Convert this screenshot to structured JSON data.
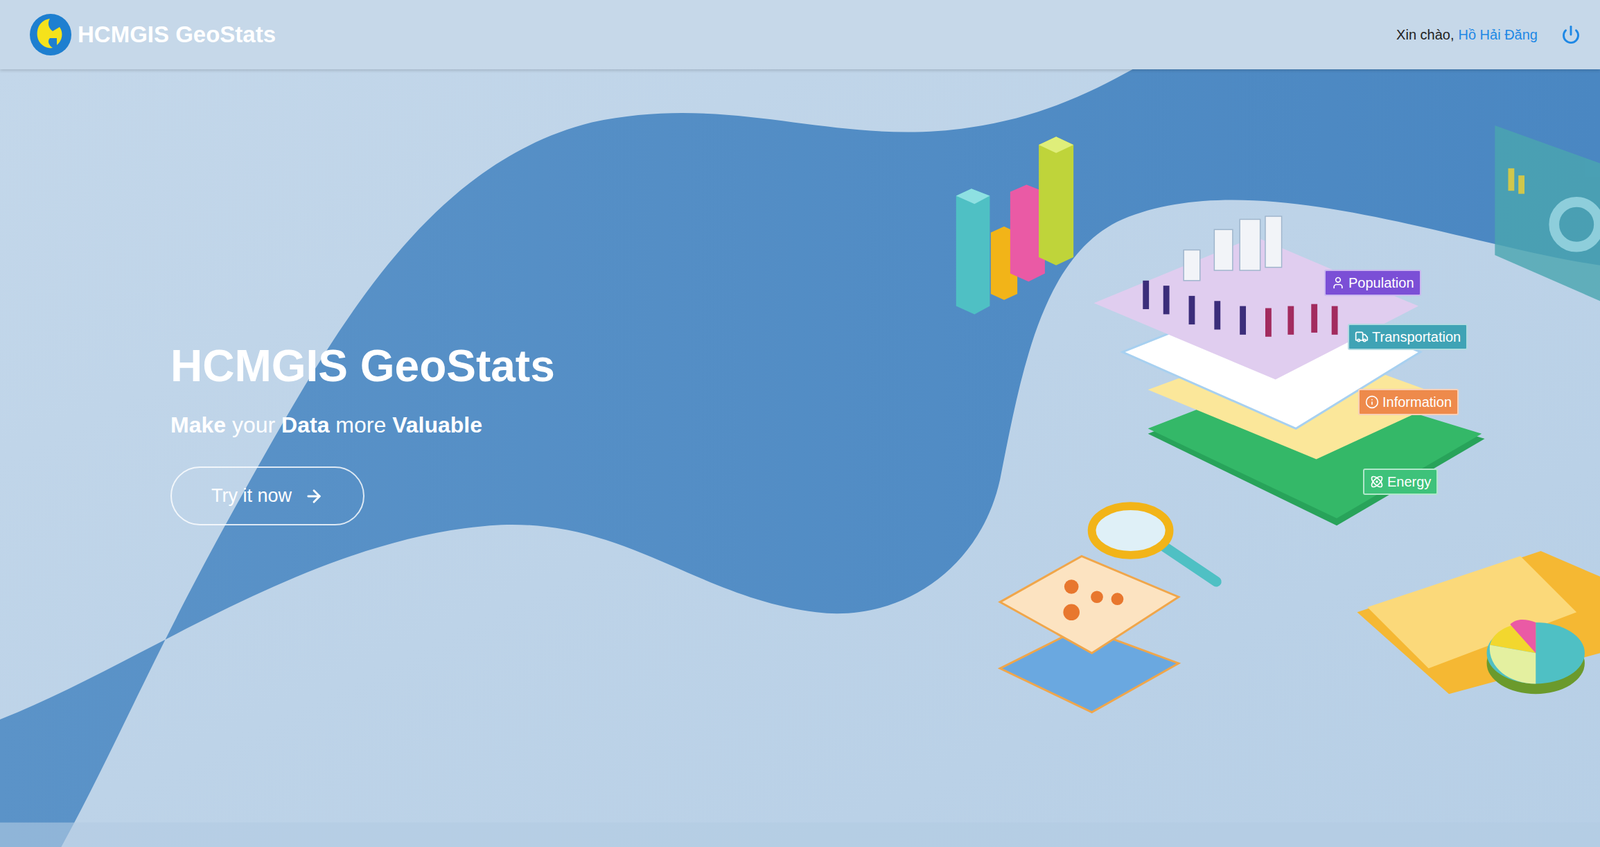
{
  "header": {
    "app_name": "HCMGIS GeoStats",
    "greeting": "Xin chào,",
    "user_name": "Hồ Hải Đăng"
  },
  "hero": {
    "title": "HCMGIS GeoStats",
    "subtitle": [
      {
        "text": "Make",
        "bold": true
      },
      {
        "text": " your ",
        "bold": false
      },
      {
        "text": "Data",
        "bold": true
      },
      {
        "text": " more ",
        "bold": false
      },
      {
        "text": "Valuable",
        "bold": true
      }
    ],
    "button": "Try it now"
  },
  "illustration": {
    "labels": [
      {
        "text": "Population",
        "color": "#7b4fd6"
      },
      {
        "text": "Transportation",
        "color": "#3fa3b5"
      },
      {
        "text": "Information",
        "color": "#ee8a4b"
      },
      {
        "text": "Energy",
        "color": "#3ec27a"
      }
    ]
  }
}
